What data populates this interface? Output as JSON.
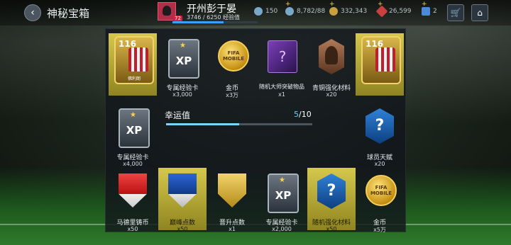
{
  "header": {
    "title": "神秘宝箱",
    "user_name": "开州彭于晏",
    "level": "72",
    "xp_text": "3746 / 6250 经验值",
    "xp_progress": 0.6
  },
  "stats": [
    {
      "value": "150",
      "icon": "energy-icon",
      "color": "#7aa8c8"
    },
    {
      "value": "8,782/88",
      "icon": "stamina-icon",
      "color": "#7aa8c8"
    },
    {
      "value": "332,343",
      "icon": "coin-icon",
      "color": "#c8a040"
    },
    {
      "value": "26,599",
      "icon": "gem-icon",
      "color": "#c84040"
    },
    {
      "value": "2",
      "icon": "fifa-points-icon",
      "color": "#4a8ad8"
    }
  ],
  "rewards_top": [
    {
      "label": "",
      "qty": "",
      "type": "player-card",
      "rating": "116",
      "player_name": "佛利朗",
      "highlighted": true
    },
    {
      "label": "专属经验卡",
      "qty": "x3,000",
      "type": "xp-card",
      "highlighted": false
    },
    {
      "label": "金币",
      "qty": "x3万",
      "type": "coin",
      "highlighted": false
    },
    {
      "label": "随机大师突破物品",
      "qty": "x1",
      "type": "purple-box",
      "highlighted": false
    },
    {
      "label": "青铜强化材料",
      "qty": "x20",
      "type": "bronze",
      "highlighted": false
    },
    {
      "label": "",
      "qty": "",
      "type": "player-card",
      "rating": "116",
      "player_name": "",
      "highlighted": true
    }
  ],
  "reward_left": {
    "label": "专属经验卡",
    "qty": "x4,000",
    "type": "xp-card"
  },
  "reward_right": {
    "label": "球员天赋",
    "qty": "x20",
    "type": "blue-hex"
  },
  "luck": {
    "label": "幸运值",
    "current": "5",
    "total": "/10",
    "progress": 0.5
  },
  "rewards_bottom": [
    {
      "label": "马德里铸币",
      "qty": "x50",
      "type": "shield-red",
      "highlighted": false
    },
    {
      "label": "巅峰点数",
      "qty": "x50",
      "type": "shield-blue",
      "highlighted": true
    },
    {
      "label": "晋升点数",
      "qty": "x1",
      "type": "shield-gold",
      "highlighted": false
    },
    {
      "label": "专属经验卡",
      "qty": "x2,000",
      "type": "xp-card",
      "highlighted": false
    },
    {
      "label": "随机强化材料",
      "qty": "x50",
      "type": "blue-hex",
      "highlighted": true
    },
    {
      "label": "金币",
      "qty": "x5万",
      "type": "coin",
      "highlighted": false
    }
  ],
  "coin_text": "FIFA MOBILE",
  "xp_glyph": "XP",
  "question_glyph": "?"
}
